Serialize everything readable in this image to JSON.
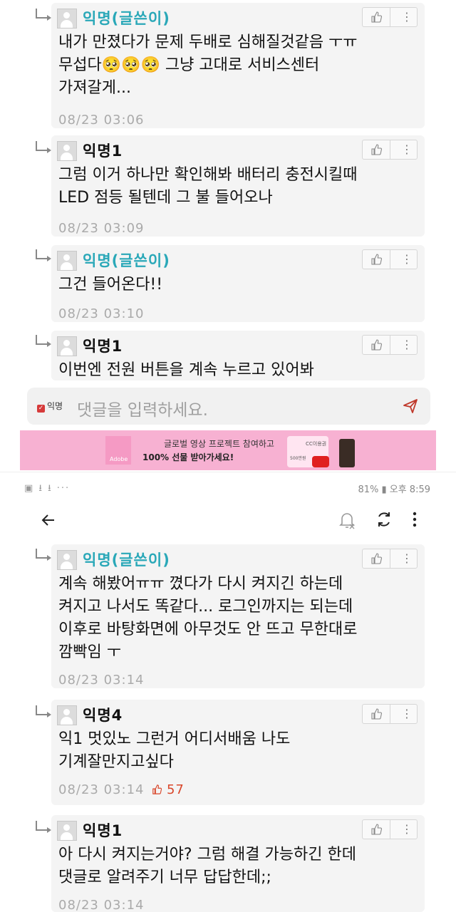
{
  "comments_top": [
    {
      "author": "익명(글쓴이)",
      "op": true,
      "text": "내가 만졌다가 문제 두배로 심해질것같음 ㅜㅠ\n무섭다🥺🥺🥺 그냥 고대로 서비스센터\n가져갈게...",
      "time": "08/23 03:06"
    },
    {
      "author": "익명1",
      "op": false,
      "text": "그럼 이거 하나만 확인해봐 배터리 충전시킬때\nLED 점등 될텐데 그 불 들어오나",
      "time": "08/23 03:09"
    },
    {
      "author": "익명(글쓴이)",
      "op": true,
      "text": "그건 들어온다!!",
      "time": "08/23 03:10"
    },
    {
      "author": "익명1",
      "op": false,
      "text": "이번엔 전원 버튼을 계속 누르고 있어봐",
      "time": ""
    }
  ],
  "input": {
    "anon_label": "익명",
    "placeholder": "댓글을 입력하세요."
  },
  "ad": {
    "brand": "Adobe",
    "line1": "글로벌 영상 프로젝트 참여하고",
    "line2": "100% 선물 받아가세요!",
    "gift_text": "CC이용권",
    "gift_sub": "500만원"
  },
  "status_bar": {
    "left_icons": "▣ ⭳ ⭳ ···",
    "right_text": "81% ▮ 오후 8:59"
  },
  "comments_bottom": [
    {
      "author": "익명(글쓴이)",
      "op": true,
      "text": "계속 해봤어ㅠㅠ 꼈다가 다시 켜지긴 하는데\n켜지고 나서도 똑같다... 로그인까지는 되는데\n이후로 바탕화면에 아무것도 안 뜨고 무한대로\n깜빡임 ㅜ",
      "time": "08/23 03:14",
      "likes": ""
    },
    {
      "author": "익명4",
      "op": false,
      "text": "익1 멋있노 그런거 어디서배움 나도\n기계잘만지고싶다",
      "time": "08/23 03:14",
      "likes": "57"
    },
    {
      "author": "익명1",
      "op": false,
      "text": "아 다시 켜지는거야? 그럼 해결 가능하긴 한데\n댓글로 알려주기 너무 답답한데;;",
      "time": "08/23 03:14",
      "likes": ""
    }
  ],
  "colors": {
    "op_author": "#2aa8b8",
    "likes": "#d9472b",
    "ad_bg": "#f7b1d2",
    "card_bg": "#f4f4f4"
  }
}
